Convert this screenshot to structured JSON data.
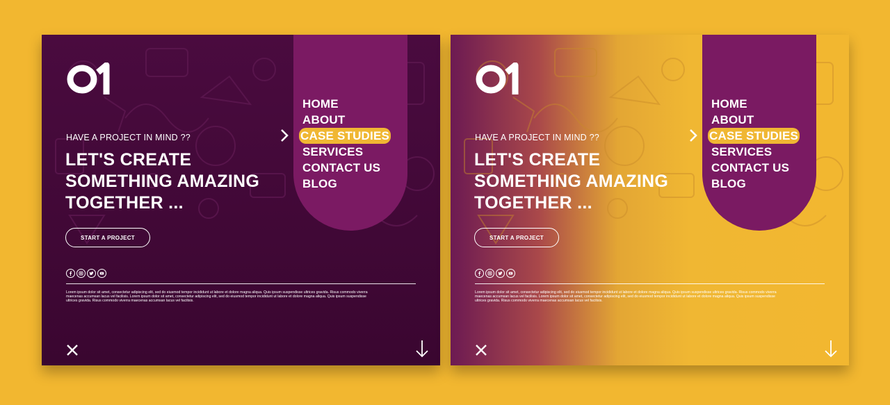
{
  "brand": {
    "logo_text": "01"
  },
  "hero": {
    "kicker": "HAVE A PROJECT IN MIND ??",
    "headline": [
      "LET'S CREATE",
      "SOMETHING AMAZING",
      "TOGETHER ..."
    ],
    "cta_label": "START A PROJECT"
  },
  "nav": {
    "items": [
      "HOME",
      "ABOUT",
      "CASE STUDIES",
      "SERVICES",
      "CONTACT US",
      "BLOG"
    ],
    "active": "CASE STUDIES"
  },
  "social": [
    "facebook-icon",
    "instagram-icon",
    "twitter-icon",
    "youtube-icon"
  ],
  "footer_text": "Lorem ipsum dolor sit amet, consectetur adipiscing elit, sed do eiusmod tempor incididunt ut labore et dolore magna aliqua. Quis ipsum suspendisse ultrices gravida. Risus commodo viverra maecenas accumsan lacus vel facilisis. Lorem ipsum dolor sit amet, consectetur adipiscing elit, sed do eiusmod tempor incididunt ut labore et dolore magna aliqua. Quis ipsum suspendisse ultrices gravida. Risus commodo viverra maecenas accumsan lacus vel facilisis.",
  "colors": {
    "page_background": "#f2b730",
    "purple_dark": "#3a0630",
    "purple_panel": "#7b1a63",
    "accent_yellow": "#f0b733"
  },
  "variants": [
    "purple",
    "purple-to-yellow-gradient"
  ]
}
